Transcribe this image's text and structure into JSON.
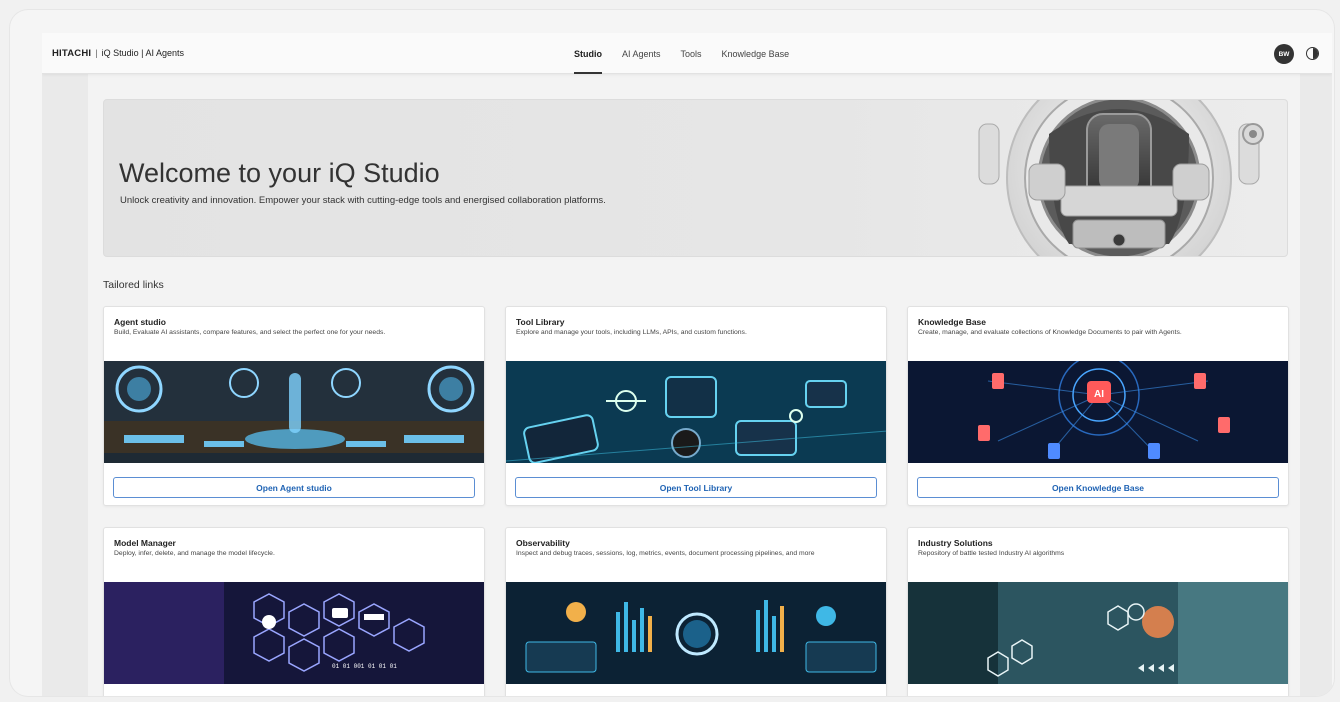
{
  "header": {
    "brand_logo": "HITACHI",
    "brand_separator": "|",
    "brand_app": "iQ Studio | AI Agents",
    "nav": [
      {
        "label": "Studio",
        "active": true
      },
      {
        "label": "AI Agents",
        "active": false
      },
      {
        "label": "Tools",
        "active": false
      },
      {
        "label": "Knowledge Base",
        "active": false
      }
    ],
    "avatar_initials": "BW",
    "theme_toggle_icon": "contrast-icon"
  },
  "hero": {
    "title": "Welcome to your iQ Studio",
    "subtitle": "Unlock creativity and innovation. Empower your stack with cutting-edge tools and energised collaboration platforms."
  },
  "section": {
    "title": "Tailored links"
  },
  "cards": [
    {
      "title": "Agent studio",
      "description": "Build, Evaluate AI assistants, compare features, and select the perfect one for your needs.",
      "button": "Open Agent studio"
    },
    {
      "title": "Tool Library",
      "description": "Explore and manage your tools, including LLMs, APIs, and custom functions.",
      "button": "Open Tool Library"
    },
    {
      "title": "Knowledge Base",
      "description": "Create, manage, and evaluate collections of Knowledge Documents to pair with Agents.",
      "button": "Open Knowledge Base"
    },
    {
      "title": "Model Manager",
      "description": "Deploy, infer, delete, and manage the model lifecycle."
    },
    {
      "title": "Observability",
      "description": "Inspect and debug traces, sessions, log, metrics, events, document processing pipelines, and more"
    },
    {
      "title": "Industry Solutions",
      "description": "Repository of battle tested Industry AI algorithms"
    }
  ],
  "images": {
    "kb_badge": "AI",
    "model_binary": "01 01 001 01 01 01"
  },
  "colors": {
    "accent": "#1f63b4",
    "button_border": "#5b8ed3",
    "nav_active": "#333333"
  }
}
